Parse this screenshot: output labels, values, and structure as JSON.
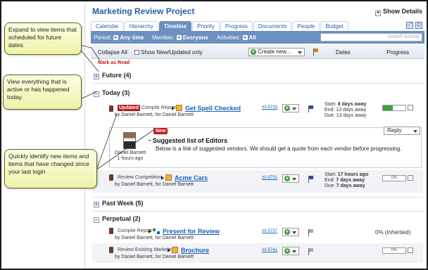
{
  "app": {
    "title": "Marketing Review Project",
    "show_details": "Show Details",
    "show_details_sign": "+"
  },
  "tabs": [
    "Calendar",
    "Hierarchy",
    "Timeline",
    "Priority",
    "Progress",
    "Documents",
    "People",
    "Budget"
  ],
  "active_tab": "Timeline",
  "filters": {
    "period_label": "Period:",
    "period_value": "Any time",
    "member_label": "Member:",
    "member_value": "Everyone",
    "activities_label": "Activities:",
    "activities_value": "All",
    "search_placeholder": "Search Activity"
  },
  "toolbar": {
    "collapse_all": "Collapse All",
    "show_new_updated": "Show New/Updated only",
    "create_new": "Create new...",
    "col_dates": "Dates",
    "col_progress": "Progress"
  },
  "mark_as_read": "Mark as Read",
  "sections": {
    "future": {
      "sign": "+",
      "label": "Future (4)"
    },
    "today": {
      "sign": "–",
      "label": "Today (3)"
    },
    "past_week": {
      "sign": "+",
      "label": "Past Week (5)"
    },
    "perpetual": {
      "sign": "–",
      "label": "Perpetual (2)"
    }
  },
  "tasks": {
    "spell": {
      "badge": "Updated",
      "category": "Compile Report",
      "name": "Get Spell Checked",
      "by": "by Daniel Barnett, for Daniel Barnett",
      "id": "#0-5733",
      "start_label": "Start:",
      "start": "8 days away",
      "end_label": "End:",
      "end": "13 days away",
      "due_label": "Due:",
      "due": "13 days away",
      "progress_pct": 45
    },
    "acme": {
      "category": "Review Competition",
      "name": "Acme Cars",
      "by": "by Daniel Barnett, for Daniel Barnett",
      "id": "#0-5731",
      "start_label": "Start:",
      "start": "17 hours ago",
      "end_label": "End:",
      "end": "7 days away",
      "due_label": "Due:",
      "due": "7 days away",
      "progress_text": "0%"
    },
    "present": {
      "category": "Compile Report",
      "name": "Present for Review",
      "by": "by Daniel Barnett, for Daniel Barnett",
      "id": "#0-5737",
      "progress_text": "0% (Inherited)"
    },
    "brochure": {
      "category": "Review Existing Marketing",
      "name": "Brochure",
      "by": "by Daniel Barnett, for Daniel Barnett",
      "id": "#0-5741",
      "progress_text": "0%"
    }
  },
  "new_item": {
    "badge": "New",
    "author": "Daniel Barnett",
    "time": "1 hours ago",
    "title": "Suggested list of Editors",
    "body": "Below is a link of suggested vendors.  We should get a quote from each vendor before progressing.",
    "reply": "Reply"
  },
  "callouts": {
    "expand": "Expand to view items that scheduled for future dates.",
    "today": "View everything that is active or has happened today.",
    "identify": "Quickly identify new items and items that have changed since your last login"
  }
}
